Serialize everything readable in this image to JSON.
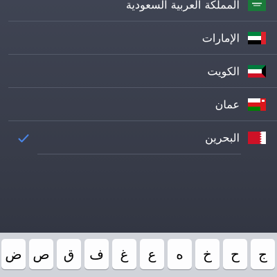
{
  "countries": [
    {
      "label": "المملكة العربية السعودية",
      "flag": "saudi-arabia-flag-icon",
      "selected": false
    },
    {
      "label": "الإمارات",
      "flag": "uae-flag-icon",
      "selected": false
    },
    {
      "label": "الكويت",
      "flag": "kuwait-flag-icon",
      "selected": false
    },
    {
      "label": "عمان",
      "flag": "oman-flag-icon",
      "selected": false
    },
    {
      "label": "البحرين",
      "flag": "bahrain-flag-icon",
      "selected": true
    }
  ],
  "checkmark": {
    "icon": "checkmark-icon",
    "color": "#4a86e8"
  },
  "keyboard": {
    "keys": [
      "ج",
      "ح",
      "خ",
      "ه",
      "ع",
      "غ",
      "ف",
      "ق",
      "ص",
      "ض"
    ]
  },
  "colors": {
    "background_top": "#3f4453",
    "background_bottom": "#2f333f",
    "separator": "#545a69",
    "keyboard_bg": "#d1d4da",
    "key_bg": "#fdfdfe"
  }
}
